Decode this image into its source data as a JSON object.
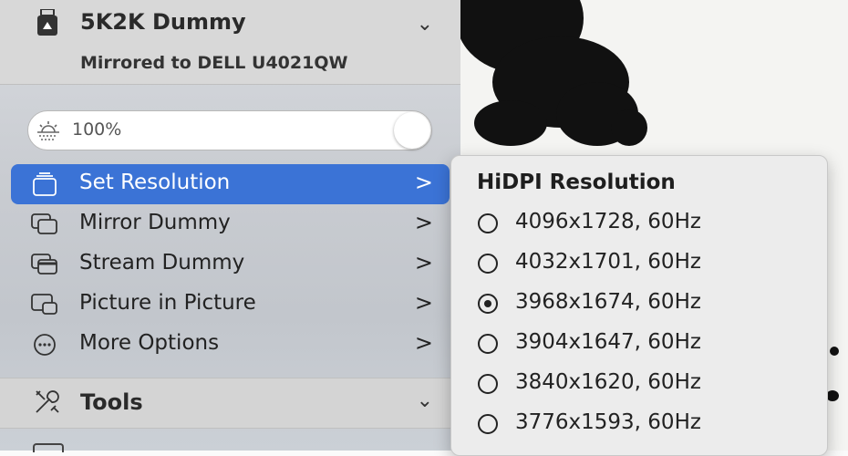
{
  "device": {
    "title": "5K2K Dummy",
    "subtitle": "Mirrored to DELL U4021QW",
    "icon": "display-dummy-icon"
  },
  "brightness": {
    "value": "100%",
    "icon": "sun-icon"
  },
  "menu": {
    "items": [
      {
        "label": "Set Resolution",
        "icon": "resolution-icon",
        "arrow": ">",
        "active": true
      },
      {
        "label": "Mirror Dummy",
        "icon": "mirror-icon",
        "arrow": ">"
      },
      {
        "label": "Stream Dummy",
        "icon": "stream-icon",
        "arrow": ">"
      },
      {
        "label": "Picture in Picture",
        "icon": "pip-icon",
        "arrow": ">"
      },
      {
        "label": "More Options",
        "icon": "ellipsis-icon",
        "arrow": ">"
      }
    ]
  },
  "tools": {
    "title": "Tools",
    "icon": "tools-icon"
  },
  "submenu": {
    "title": "HiDPI Resolution",
    "options": [
      {
        "label": "4096x1728, 60Hz",
        "selected": false
      },
      {
        "label": "4032x1701, 60Hz",
        "selected": false
      },
      {
        "label": "3968x1674, 60Hz",
        "selected": true
      },
      {
        "label": "3904x1647, 60Hz",
        "selected": false
      },
      {
        "label": "3840x1620, 60Hz",
        "selected": false
      },
      {
        "label": "3776x1593, 60Hz",
        "selected": false
      }
    ]
  },
  "colors": {
    "accent": "#3b73d6"
  }
}
